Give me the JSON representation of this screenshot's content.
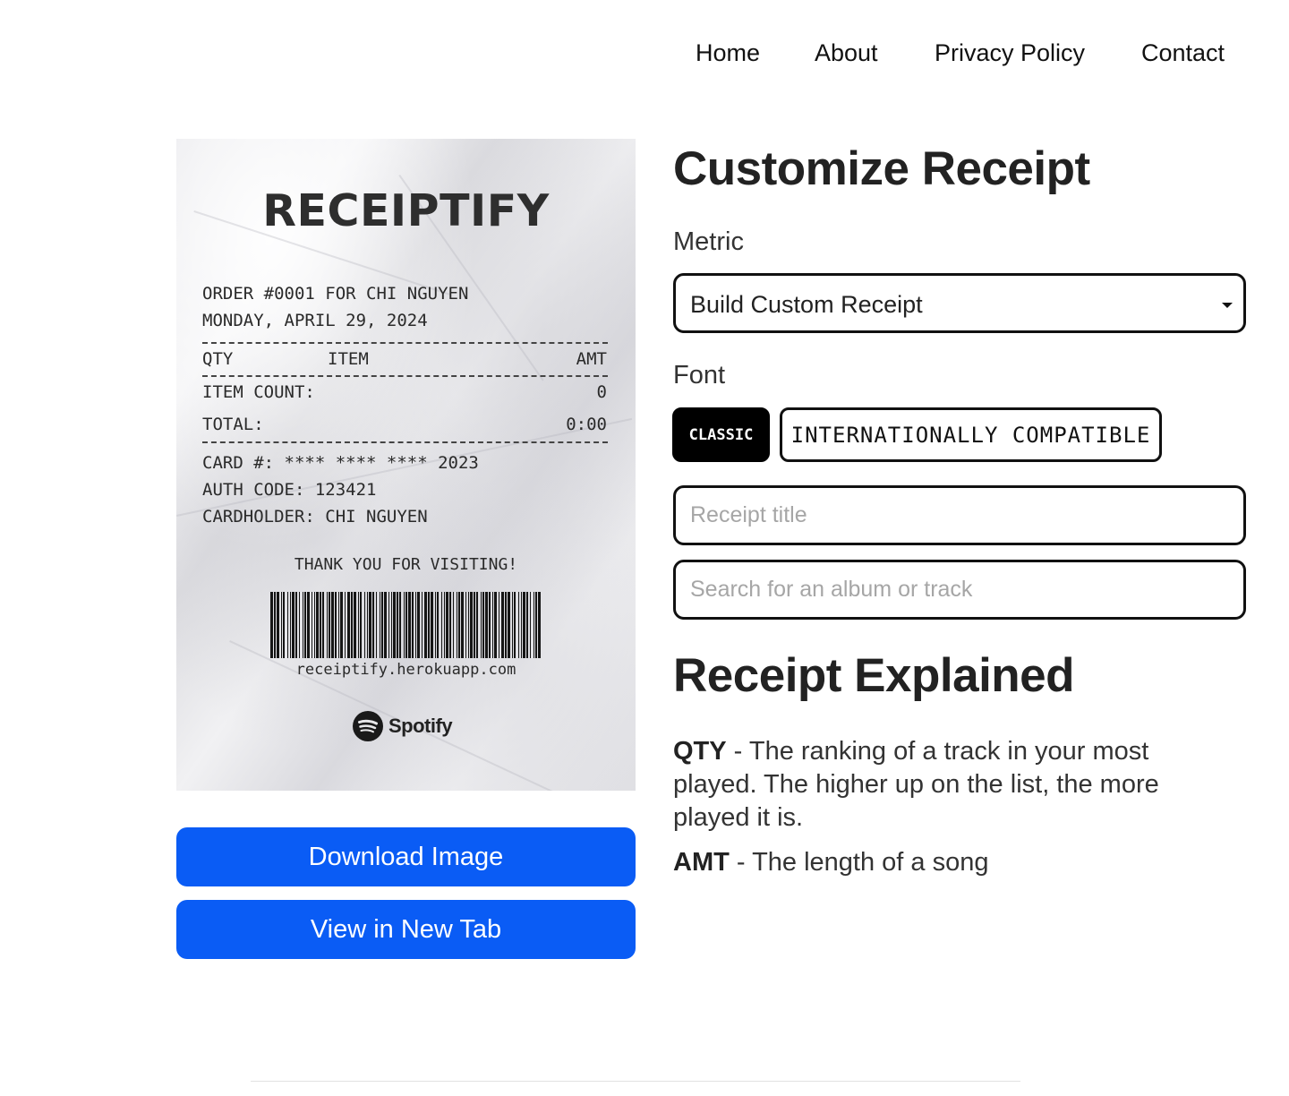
{
  "nav": {
    "items": [
      "Home",
      "About",
      "Privacy Policy",
      "Contact"
    ]
  },
  "receipt": {
    "title": "RECEIPTIFY",
    "order_line": "ORDER #0001 FOR CHI NGUYEN",
    "date_line": "MONDAY, APRIL 29, 2024",
    "col_qty": "QTY",
    "col_item": "ITEM",
    "col_amt": "AMT",
    "item_count_label": "ITEM COUNT:",
    "item_count_value": "0",
    "total_label": "TOTAL:",
    "total_value": "0:00",
    "card_line": "CARD #: **** **** **** 2023",
    "auth_line": "AUTH CODE: 123421",
    "cardholder_line": "CARDHOLDER: CHI NGUYEN",
    "thanks": "THANK YOU FOR VISITING!",
    "url": "receiptify.herokuapp.com",
    "brand": "Spotify"
  },
  "actions": {
    "download": "Download Image",
    "new_tab": "View in New Tab"
  },
  "customize": {
    "heading": "Customize Receipt",
    "metric_label": "Metric",
    "metric_value": "Build Custom Receipt",
    "font_label": "Font",
    "font_classic": "CLASSIC",
    "font_intl": "INTERNATIONALLY COMPATIBLE",
    "title_placeholder": "Receipt title",
    "search_placeholder": "Search for an album or track"
  },
  "explained": {
    "heading": "Receipt Explained",
    "qty_term": "QTY",
    "qty_text": " - The ranking of a track in your most played. The higher up on the list, the more played it is.",
    "amt_term": "AMT",
    "amt_text": " - The length of a song"
  },
  "colors": {
    "accent": "#0a5cf5",
    "dark": "#000000"
  }
}
